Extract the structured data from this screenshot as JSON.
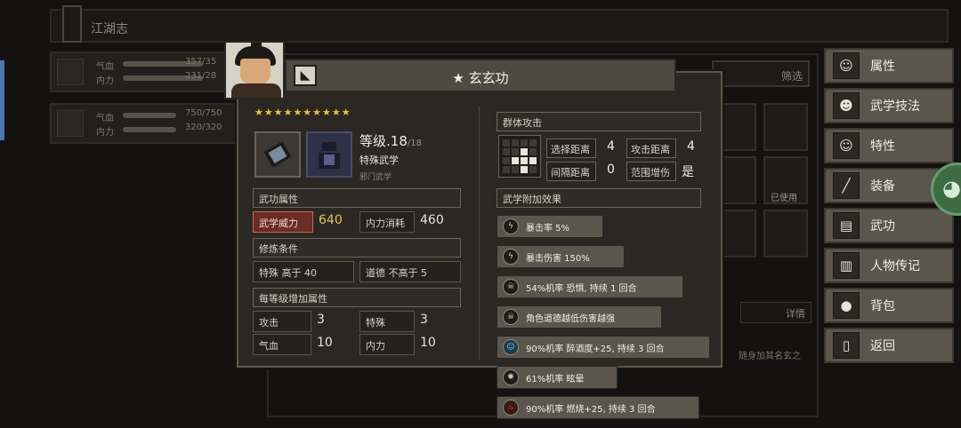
{
  "background": {
    "header_title": "江湖志",
    "characters": [
      {
        "hp": "357/35",
        "mp": "231/28",
        "hp_label": "气血",
        "mp_label": "内力"
      },
      {
        "hp": "750/750",
        "mp": "320/320",
        "hp_label": "气血",
        "mp_label": "内力"
      }
    ],
    "filter_label": "筛选",
    "used_label": "已使用",
    "detail_label": "详情",
    "desc_text": "随身加其名玄之"
  },
  "menu": [
    {
      "label": "属性",
      "icon": "person-icon"
    },
    {
      "label": "武学技法",
      "icon": "martial-icon"
    },
    {
      "label": "特性",
      "icon": "trait-icon"
    },
    {
      "label": "装备",
      "icon": "sword-icon"
    },
    {
      "label": "武功",
      "icon": "book-icon"
    },
    {
      "label": "人物传记",
      "icon": "scroll-icon"
    },
    {
      "label": "背包",
      "icon": "bag-icon"
    },
    {
      "label": "返回",
      "icon": "door-icon"
    }
  ],
  "skill": {
    "title": "★ 玄玄功",
    "stars": "★★★★★★★★★★",
    "level_label": "等级",
    "level": ".18",
    "level_max": "/18",
    "type": "特殊武学",
    "school": "邪门武学",
    "sections": {
      "attributes": "武功属性",
      "requirements": "修炼条件",
      "per_level": "每等级增加属性",
      "range_title": "群体攻击",
      "effects_title": "武学附加效果"
    },
    "power_label": "武学威力",
    "power_value": "640",
    "mp_cost_label": "内力消耗",
    "mp_cost_value": "460",
    "req": [
      {
        "label": "特殊",
        "text": "高于 40"
      },
      {
        "label": "道德",
        "text": "不高于 5"
      }
    ],
    "per_level": [
      {
        "label": "攻击",
        "value": "3"
      },
      {
        "label": "特殊",
        "value": "3"
      },
      {
        "label": "气血",
        "value": "10"
      },
      {
        "label": "内力",
        "value": "10"
      }
    ],
    "range": [
      {
        "label": "选择距离",
        "value": "4"
      },
      {
        "label": "攻击距离",
        "value": "4"
      },
      {
        "label": "间隔距离",
        "value": "0"
      },
      {
        "label": "范围增伤",
        "value": "是"
      }
    ],
    "effects": [
      {
        "text": "暴击率 5%",
        "icon": "lightning-icon"
      },
      {
        "text": "暴击伤害 150%",
        "icon": "lightning-icon"
      },
      {
        "text": "54%机率 恐惧, 持续 1 回合",
        "icon": "skull-icon"
      },
      {
        "text": "角色道德越低伤害越强",
        "icon": "skull-icon"
      },
      {
        "text": "90%机率 醉酒度+25, 持续 3 回合",
        "icon": "wine-icon"
      },
      {
        "text": "61%机率 眩晕",
        "icon": "dizzy-icon"
      },
      {
        "text": "90%机率 燃烧+25, 持续 3 回合",
        "icon": "fire-icon"
      }
    ]
  }
}
